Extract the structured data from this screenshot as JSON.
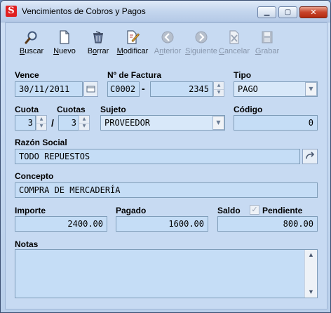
{
  "window": {
    "title": "Vencimientos de Cobros y Pagos",
    "app_icon_glyph": "S",
    "controls": {
      "minimize": "▁",
      "maximize": "▢",
      "close": "✕"
    }
  },
  "toolbar": {
    "buscar": {
      "first": "B",
      "rest": "uscar",
      "icon": "search-icon"
    },
    "nuevo": {
      "first": "N",
      "rest": "uevo",
      "icon": "new-document-icon"
    },
    "borrar": {
      "pre": "B",
      "u": "o",
      "rest": "rrar",
      "icon": "trash-icon"
    },
    "modificar": {
      "first": "M",
      "rest": "odificar",
      "icon": "edit-document-icon"
    },
    "anterior": {
      "pre": "A",
      "u": "n",
      "rest": "terior",
      "icon": "arrow-left-icon"
    },
    "siguiente": {
      "first": "S",
      "rest": "iguiente",
      "icon": "arrow-right-icon"
    },
    "cancelar": {
      "first": "C",
      "rest": "ancelar",
      "icon": "cancel-icon"
    },
    "grabar": {
      "first": "G",
      "rest": "rabar",
      "icon": "save-icon"
    }
  },
  "form": {
    "vence": {
      "label": "Vence",
      "value": "30/11/2011"
    },
    "factura": {
      "label": "Nº de Factura",
      "prefix": "C0002",
      "separator": "-",
      "number": "2345"
    },
    "tipo": {
      "label": "Tipo",
      "value": "PAGO"
    },
    "cuota": {
      "label": "Cuota",
      "value": "3"
    },
    "cuotas": {
      "label": "Cuotas",
      "value": "3",
      "separator": "/"
    },
    "sujeto": {
      "label": "Sujeto",
      "value": "PROVEEDOR"
    },
    "codigo": {
      "label": "Código",
      "value": "0"
    },
    "razon_social": {
      "label": "Razón Social",
      "value": "TODO REPUESTOS"
    },
    "concepto": {
      "label": "Concepto",
      "value": "COMPRA DE MERCADERÍA"
    },
    "importe": {
      "label": "Importe",
      "value": "2400.00"
    },
    "pagado": {
      "label": "Pagado",
      "value": "1600.00"
    },
    "saldo": {
      "label": "Saldo",
      "value": "800.00"
    },
    "pendiente": {
      "label": "Pendiente",
      "checked": true
    },
    "notas": {
      "label": "Notas",
      "value": ""
    }
  }
}
